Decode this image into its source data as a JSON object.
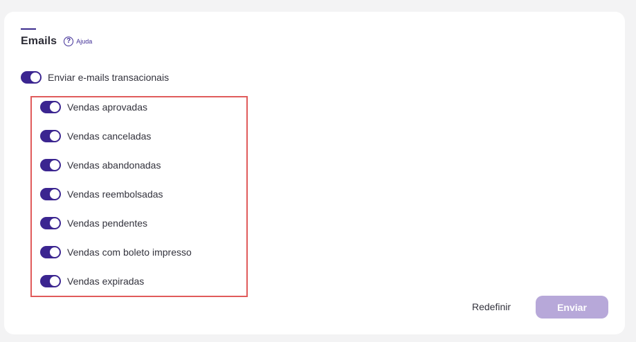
{
  "section": {
    "title": "Emails",
    "help_label": "Ajuda"
  },
  "master_toggle": {
    "label": "Enviar e-mails transacionais",
    "checked": true
  },
  "toggles": [
    {
      "label": "Vendas aprovadas",
      "checked": true
    },
    {
      "label": "Vendas canceladas",
      "checked": true
    },
    {
      "label": "Vendas abandonadas",
      "checked": true
    },
    {
      "label": "Vendas reembolsadas",
      "checked": true
    },
    {
      "label": "Vendas pendentes",
      "checked": true
    },
    {
      "label": "Vendas com boleto impresso",
      "checked": true
    },
    {
      "label": "Vendas expiradas",
      "checked": true
    }
  ],
  "actions": {
    "reset_label": "Redefinir",
    "submit_label": "Enviar"
  },
  "colors": {
    "toggle_on": "#3b2590",
    "submit_disabled": "#b7a8d9",
    "highlight": "#e05a5a"
  }
}
